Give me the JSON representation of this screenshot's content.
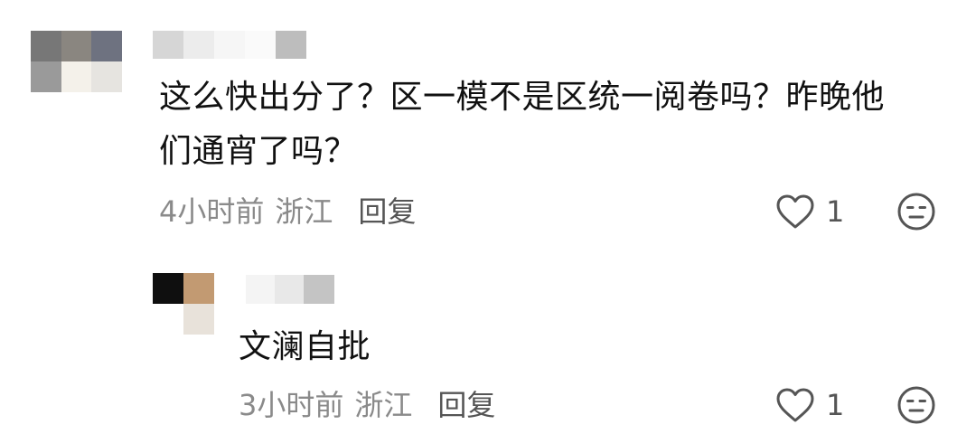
{
  "comments": [
    {
      "text_lines": [
        "这么快出分了？区一模不是区统一阅卷吗？昨晚他",
        "们通宵了吗？"
      ],
      "time": "4小时前",
      "location": "浙江",
      "reply_label": "回复",
      "likes": "1",
      "avatar_pixels": [
        "#777777",
        "#8a8680",
        "#6e7280",
        "#9a9a9a",
        "#f4f1ea",
        "#e6e4e0"
      ],
      "username_pixels": [
        "#d6d6d6",
        "#ececec",
        "#f6f6f6",
        "#fafafa",
        "#bdbdbd"
      ]
    },
    {
      "text_lines": [
        "文澜自批"
      ],
      "time": "3小时前",
      "location": "浙江",
      "reply_label": "回复",
      "likes": "1",
      "avatar_pixels": [
        "#0f0f0f",
        "#c29a72",
        "#ffffff",
        "#e8e2da"
      ],
      "username_pixels": [
        "#f4f4f4",
        "#e8e8e8",
        "#c4c4c4"
      ]
    }
  ],
  "colors": {
    "text": "#111111",
    "meta": "#8a8a8a",
    "action": "#555555"
  },
  "icons": {
    "like": "heart-outline-icon",
    "dislike": "neutral-face-icon"
  }
}
